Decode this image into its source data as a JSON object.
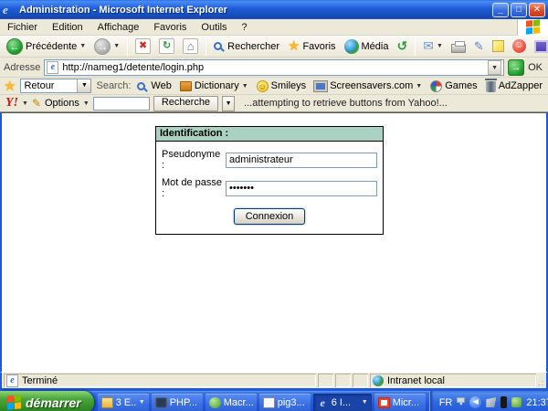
{
  "window": {
    "title": "Administration - Microsoft Internet Explorer"
  },
  "menu": {
    "items": [
      "Fichier",
      "Edition",
      "Affichage",
      "Favoris",
      "Outils",
      "?"
    ]
  },
  "toolbar": {
    "back_label": "Précédente",
    "search_label": "Rechercher",
    "favorites_label": "Favoris",
    "media_label": "Média"
  },
  "address_bar": {
    "label": "Adresse",
    "url": "http://nameg1/detente/login.php",
    "go_label": "OK"
  },
  "search_toolbar": {
    "combo_value": "Retour",
    "search_label": "Search:",
    "items": [
      "Web",
      "Dictionary",
      "Smileys",
      "Screensavers.com",
      "Games",
      "AdZapper"
    ]
  },
  "yahoo_toolbar": {
    "logo": "Y!",
    "options_label": "Options",
    "search_value": "",
    "button_label": "Recherche",
    "status_text": "...attempting to retrieve buttons from Yahoo!..."
  },
  "login_form": {
    "title": "Identification :",
    "username_label": "Pseudonyme :",
    "username_value": "administrateur",
    "password_label": "Mot de passe :",
    "password_value": "•••••••",
    "submit_label": "Connexion",
    "header_color": "#a9d2c2"
  },
  "status_bar": {
    "left": "Terminé",
    "right": "Intranet local"
  },
  "taskbar": {
    "start_label": "démarrer",
    "tasks": [
      {
        "label": "3 E..."
      },
      {
        "label": "PHP..."
      },
      {
        "label": "Macr..."
      },
      {
        "label": "pig3..."
      },
      {
        "label": "6 I..."
      },
      {
        "label": "Micr..."
      }
    ],
    "tray": {
      "language": "FR",
      "time": "21:37"
    }
  },
  "colors": {
    "form_header": "#a9d2c2",
    "title_bar_blue": "#1f5cd8",
    "taskbar_blue": "#2458d8",
    "start_green": "#3f9c34"
  }
}
